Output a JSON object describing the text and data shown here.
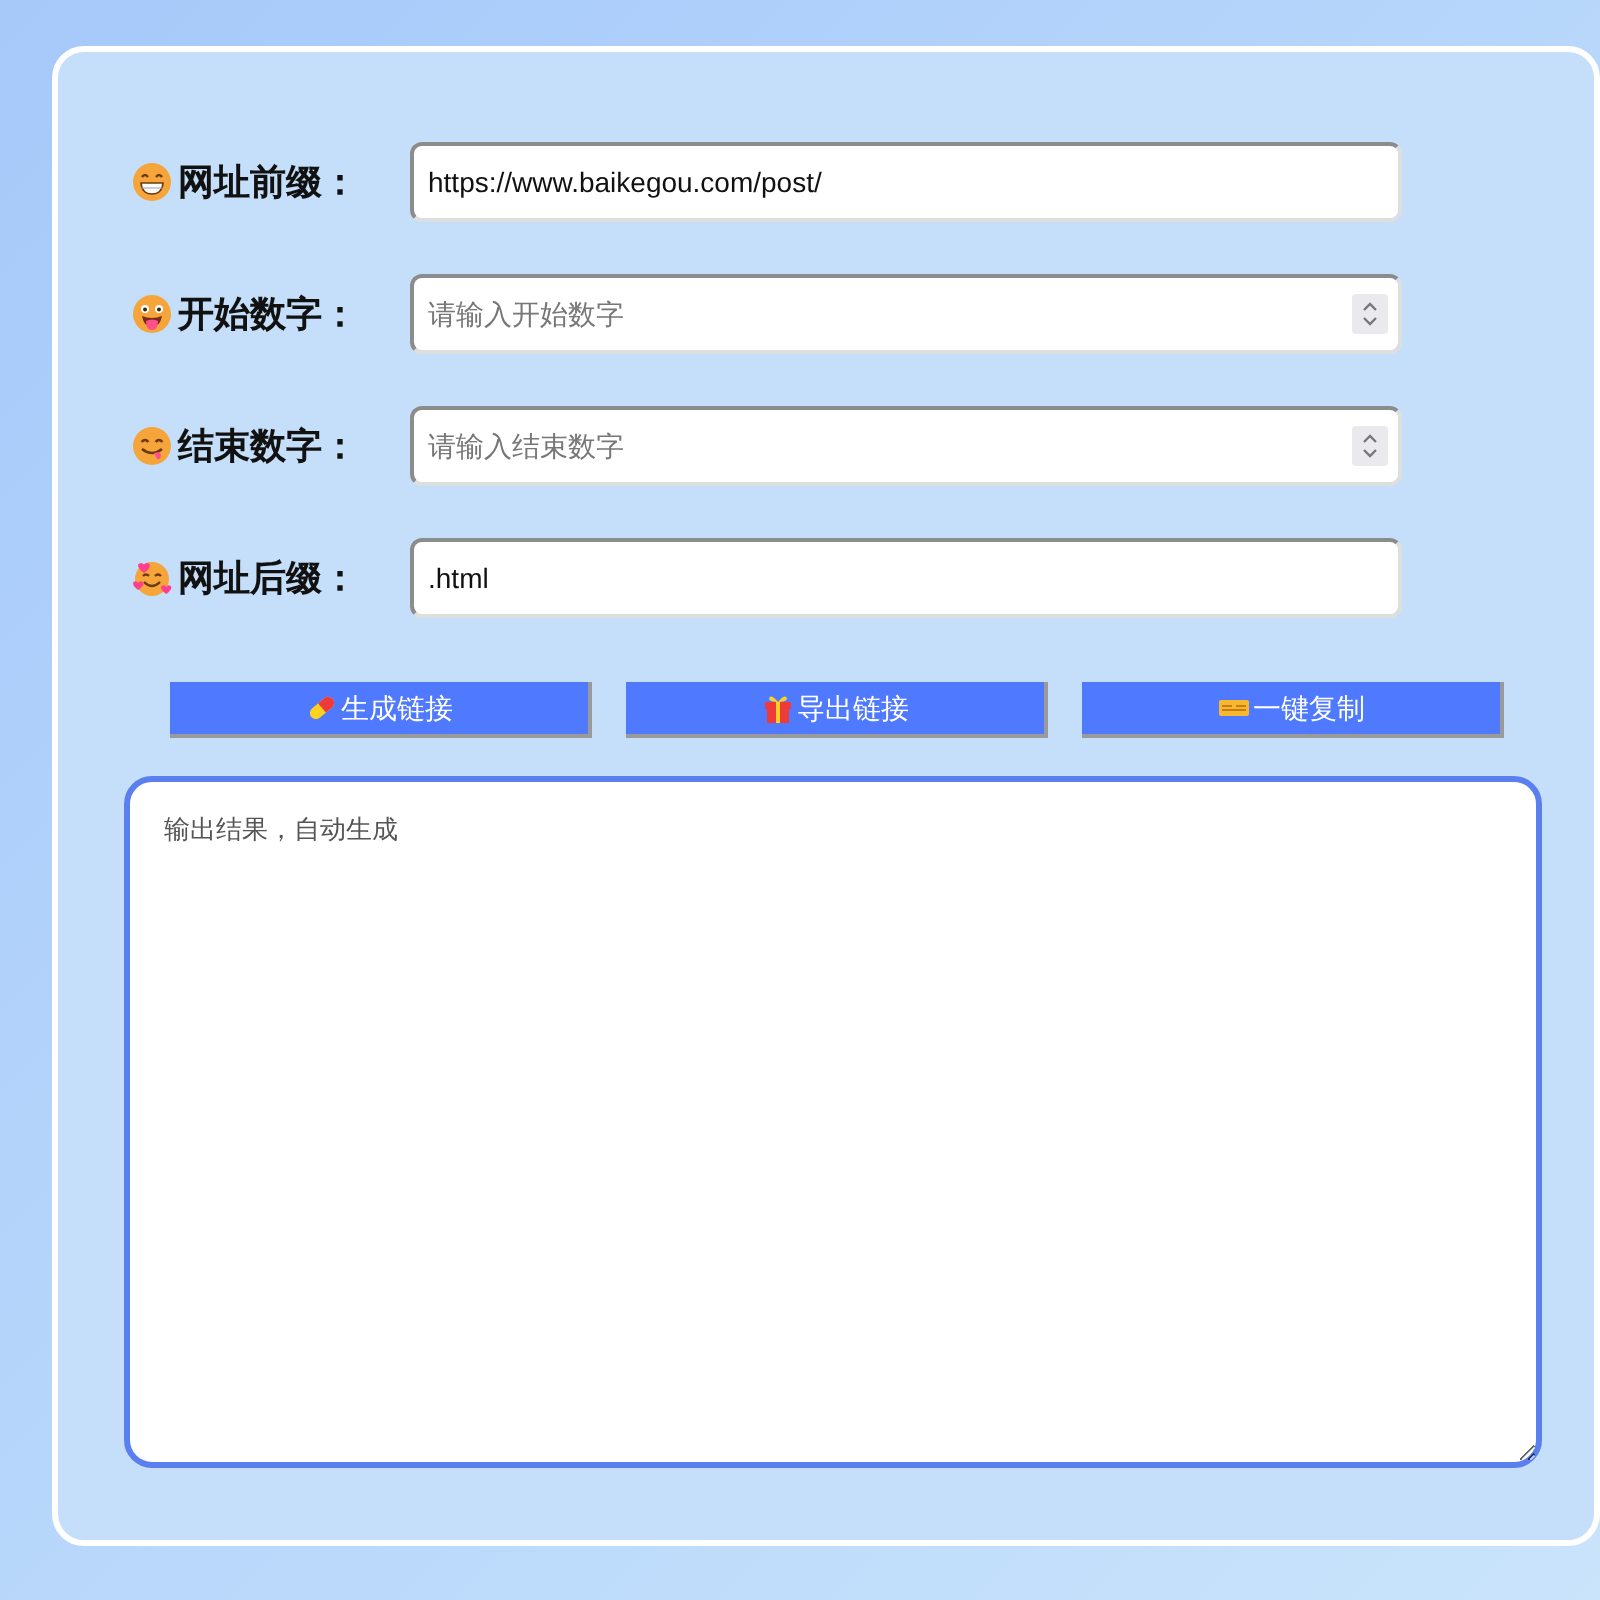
{
  "fields": [
    {
      "kind": "text",
      "label": "网址前缀：",
      "value": "https://www.baikegou.com/post/"
    },
    {
      "kind": "number",
      "label": "开始数字：",
      "placeholder": "请输入开始数字"
    },
    {
      "kind": "number",
      "label": "结束数字：",
      "placeholder": "请输入结束数字"
    },
    {
      "kind": "text",
      "label": "网址后缀：",
      "value": ".html"
    }
  ],
  "buttons": [
    {
      "label": "生成链接"
    },
    {
      "label": "导出链接"
    },
    {
      "label": "一键复制"
    }
  ],
  "output": {
    "placeholder": "输出结果，自动生成"
  }
}
